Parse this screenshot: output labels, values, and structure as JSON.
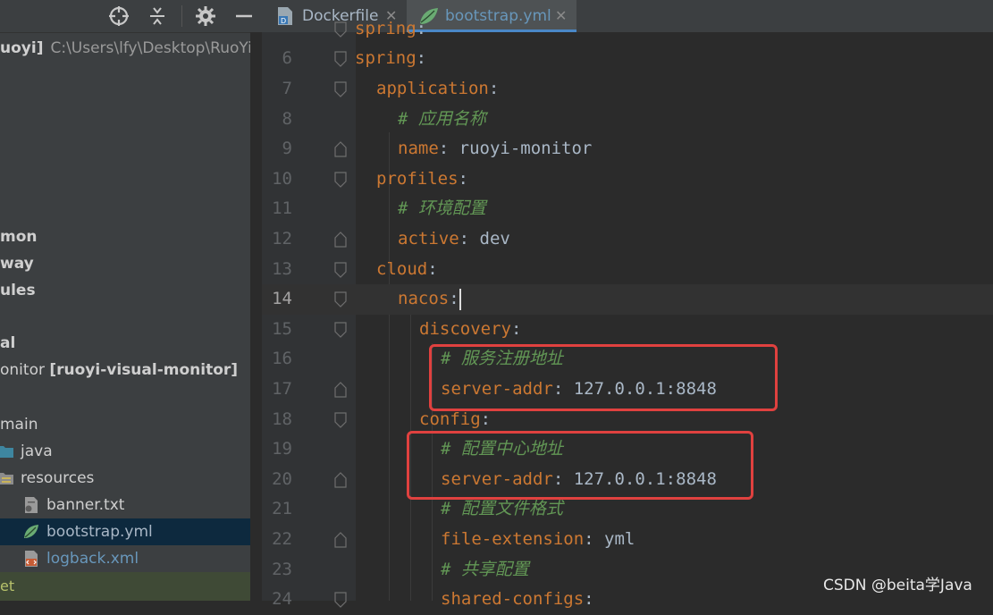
{
  "tabs": [
    {
      "label": "Dockerfile",
      "icon": "dockerfile-icon",
      "active": false
    },
    {
      "label": "bootstrap.yml",
      "icon": "spring-leaf-icon",
      "active": true
    }
  ],
  "project": {
    "root_name": "uoyi]",
    "root_path": "C:\\Users\\lfy\\Desktop\\RuoYi-C",
    "tree": [
      {
        "label": "mon",
        "bold": true
      },
      {
        "label": "way",
        "bold": true
      },
      {
        "label": "ules",
        "bold": true
      },
      {
        "label": "al",
        "bold": true
      },
      {
        "label": "onitor ",
        "module": "[ruoyi-visual-monitor]"
      },
      {
        "label": "main"
      },
      {
        "label": "java"
      },
      {
        "label": "resources"
      },
      {
        "label": "banner.txt"
      },
      {
        "label": "bootstrap.yml",
        "selected": true
      },
      {
        "label": "logback.xml"
      }
    ],
    "bottom_strip": "et"
  },
  "editor": {
    "current_line": 14,
    "lines": [
      {
        "n": "",
        "key": "spring",
        "sep": ":",
        "val": ""
      },
      {
        "n": "6",
        "key": "spring",
        "sep": ":",
        "val": ""
      },
      {
        "n": "7",
        "key": "application",
        "sep": ":",
        "val": ""
      },
      {
        "n": "8",
        "comment": "# 应用名称"
      },
      {
        "n": "9",
        "key": "name",
        "sep": ":",
        "val": " ruoyi-monitor"
      },
      {
        "n": "10",
        "key": "profiles",
        "sep": ":",
        "val": ""
      },
      {
        "n": "11",
        "comment": "# 环境配置"
      },
      {
        "n": "12",
        "key": "active",
        "sep": ":",
        "val": " dev"
      },
      {
        "n": "13",
        "key": "cloud",
        "sep": ":",
        "val": ""
      },
      {
        "n": "14",
        "key": "nacos",
        "sep": ":",
        "val": ""
      },
      {
        "n": "15",
        "key": "discovery",
        "sep": ":",
        "val": ""
      },
      {
        "n": "16",
        "comment": "# 服务注册地址"
      },
      {
        "n": "17",
        "key": "server-addr",
        "sep": ":",
        "val": " 127.0.0.1:8848"
      },
      {
        "n": "18",
        "key": "config",
        "sep": ":",
        "val": ""
      },
      {
        "n": "19",
        "comment": "# 配置中心地址"
      },
      {
        "n": "20",
        "key": "server-addr",
        "sep": ":",
        "val": " 127.0.0.1:8848"
      },
      {
        "n": "21",
        "comment": "# 配置文件格式"
      },
      {
        "n": "22",
        "key": "file-extension",
        "sep": ":",
        "val": " yml"
      },
      {
        "n": "23",
        "comment": "# 共享配置"
      },
      {
        "n": "24",
        "key": "shared-configs",
        "sep": ":",
        "val": ""
      }
    ]
  },
  "watermark": "CSDN @beita学Java",
  "colors": {
    "key": "#cc7832",
    "value": "#a9b7c6",
    "comment": "#629755",
    "highlight": "#e0413f",
    "selection": "#0d293e"
  }
}
